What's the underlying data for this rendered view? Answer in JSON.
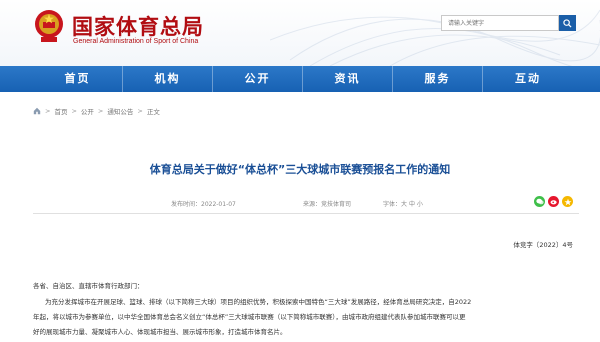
{
  "header": {
    "title": "国家体育总局",
    "subtitle": "General Administration of Sport of China",
    "search_placeholder": "请输入关键字"
  },
  "nav": [
    "首页",
    "机构",
    "公开",
    "资讯",
    "服务",
    "互动"
  ],
  "breadcrumb": [
    "首页",
    "公开",
    "通知公告",
    "正文"
  ],
  "article": {
    "title": "体育总局关于做好“体总杯”三大球城市联赛预报名工作的通知",
    "date_label": "发布时间：2022-01-07",
    "source_label": "来源：竞技体育司",
    "font_label": "字体：",
    "font_sizes": [
      "大",
      "中",
      "小"
    ],
    "doc_number": "体竞字〔2022〕4号",
    "para1": "各省、自治区、直辖市体育行政部门：",
    "para2_line1": "为充分发挥城市在开展足球、篮球、排球（以下简称三大球）项目的组织优势，积极探索中国特色“三大球”发展路径，经体育总局研究决定，自2022",
    "para2_line2": "年起，将以城市为参赛单位，以中华全国体育总会名义创立“体总杯”三大球城市联赛（以下简称城市联赛），由城市政府组建代表队参加城市联赛可以更",
    "para2_line3": "好的展现城市力量、凝聚城市人心、体现城市担当、展示城市形象，打造城市体育名片。"
  },
  "icons": {
    "search": "search-icon",
    "emblem": "national-emblem-icon",
    "wechat": "wechat-icon",
    "weibo": "weibo-icon",
    "qzone": "qzone-icon"
  },
  "colors": {
    "brand_red": "#b10d12",
    "nav_blue": "#1a66b8",
    "title_blue": "#1a4f96"
  }
}
